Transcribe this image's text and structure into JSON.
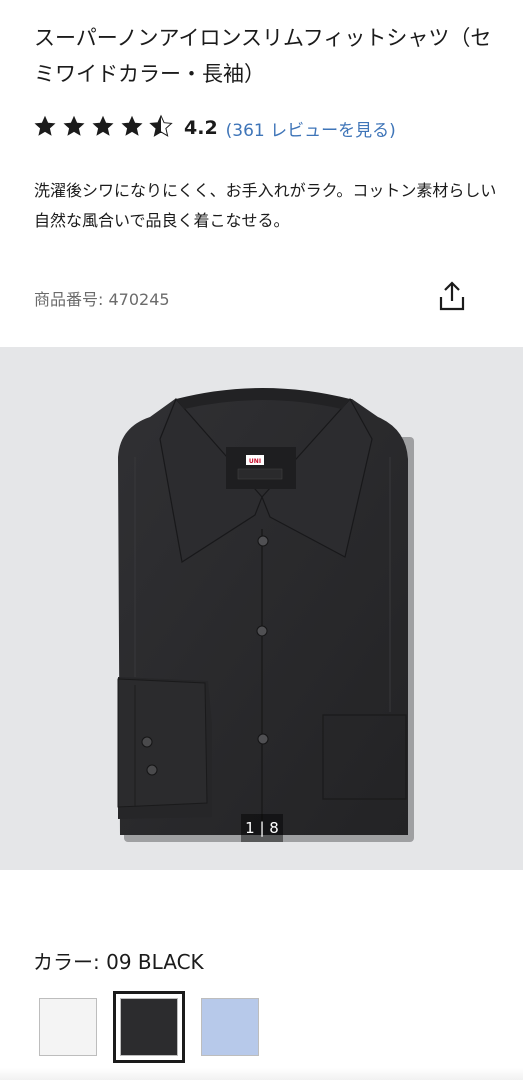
{
  "product": {
    "title": "スーパーノンアイロンスリムフィットシャツ（セミワイドカラー・長袖）",
    "rating_value": "4.2",
    "rating_stars": 4.2,
    "reviews_link": "(361 レビューを見る)",
    "description": "洗濯後シワになりにくく、お手入れがラク。コットン素材らしい自然な風合いで品良く着こなせる。",
    "code_label": "商品番号:",
    "code_value": "470245"
  },
  "icons": {
    "star": "star-icon",
    "share": "share-icon"
  },
  "gallery": {
    "counter": "1 | 8",
    "current": 1,
    "total": 8,
    "shirt_label_brand": "UNIQLO",
    "background_color": "#e5e6e8",
    "shirt_color": "#2a2a2c"
  },
  "color": {
    "label": "カラー:",
    "selected_name": "09 BLACK",
    "swatches": [
      {
        "name": "white",
        "hex": "#f4f4f4",
        "selected": false
      },
      {
        "name": "black",
        "hex": "#2c2c2e",
        "selected": true
      },
      {
        "name": "blue",
        "hex": "#b7c9ea",
        "selected": false
      }
    ]
  },
  "colors": {
    "text": "#1b1b1b",
    "link": "#3f75b8",
    "muted": "#6b6b6b"
  }
}
